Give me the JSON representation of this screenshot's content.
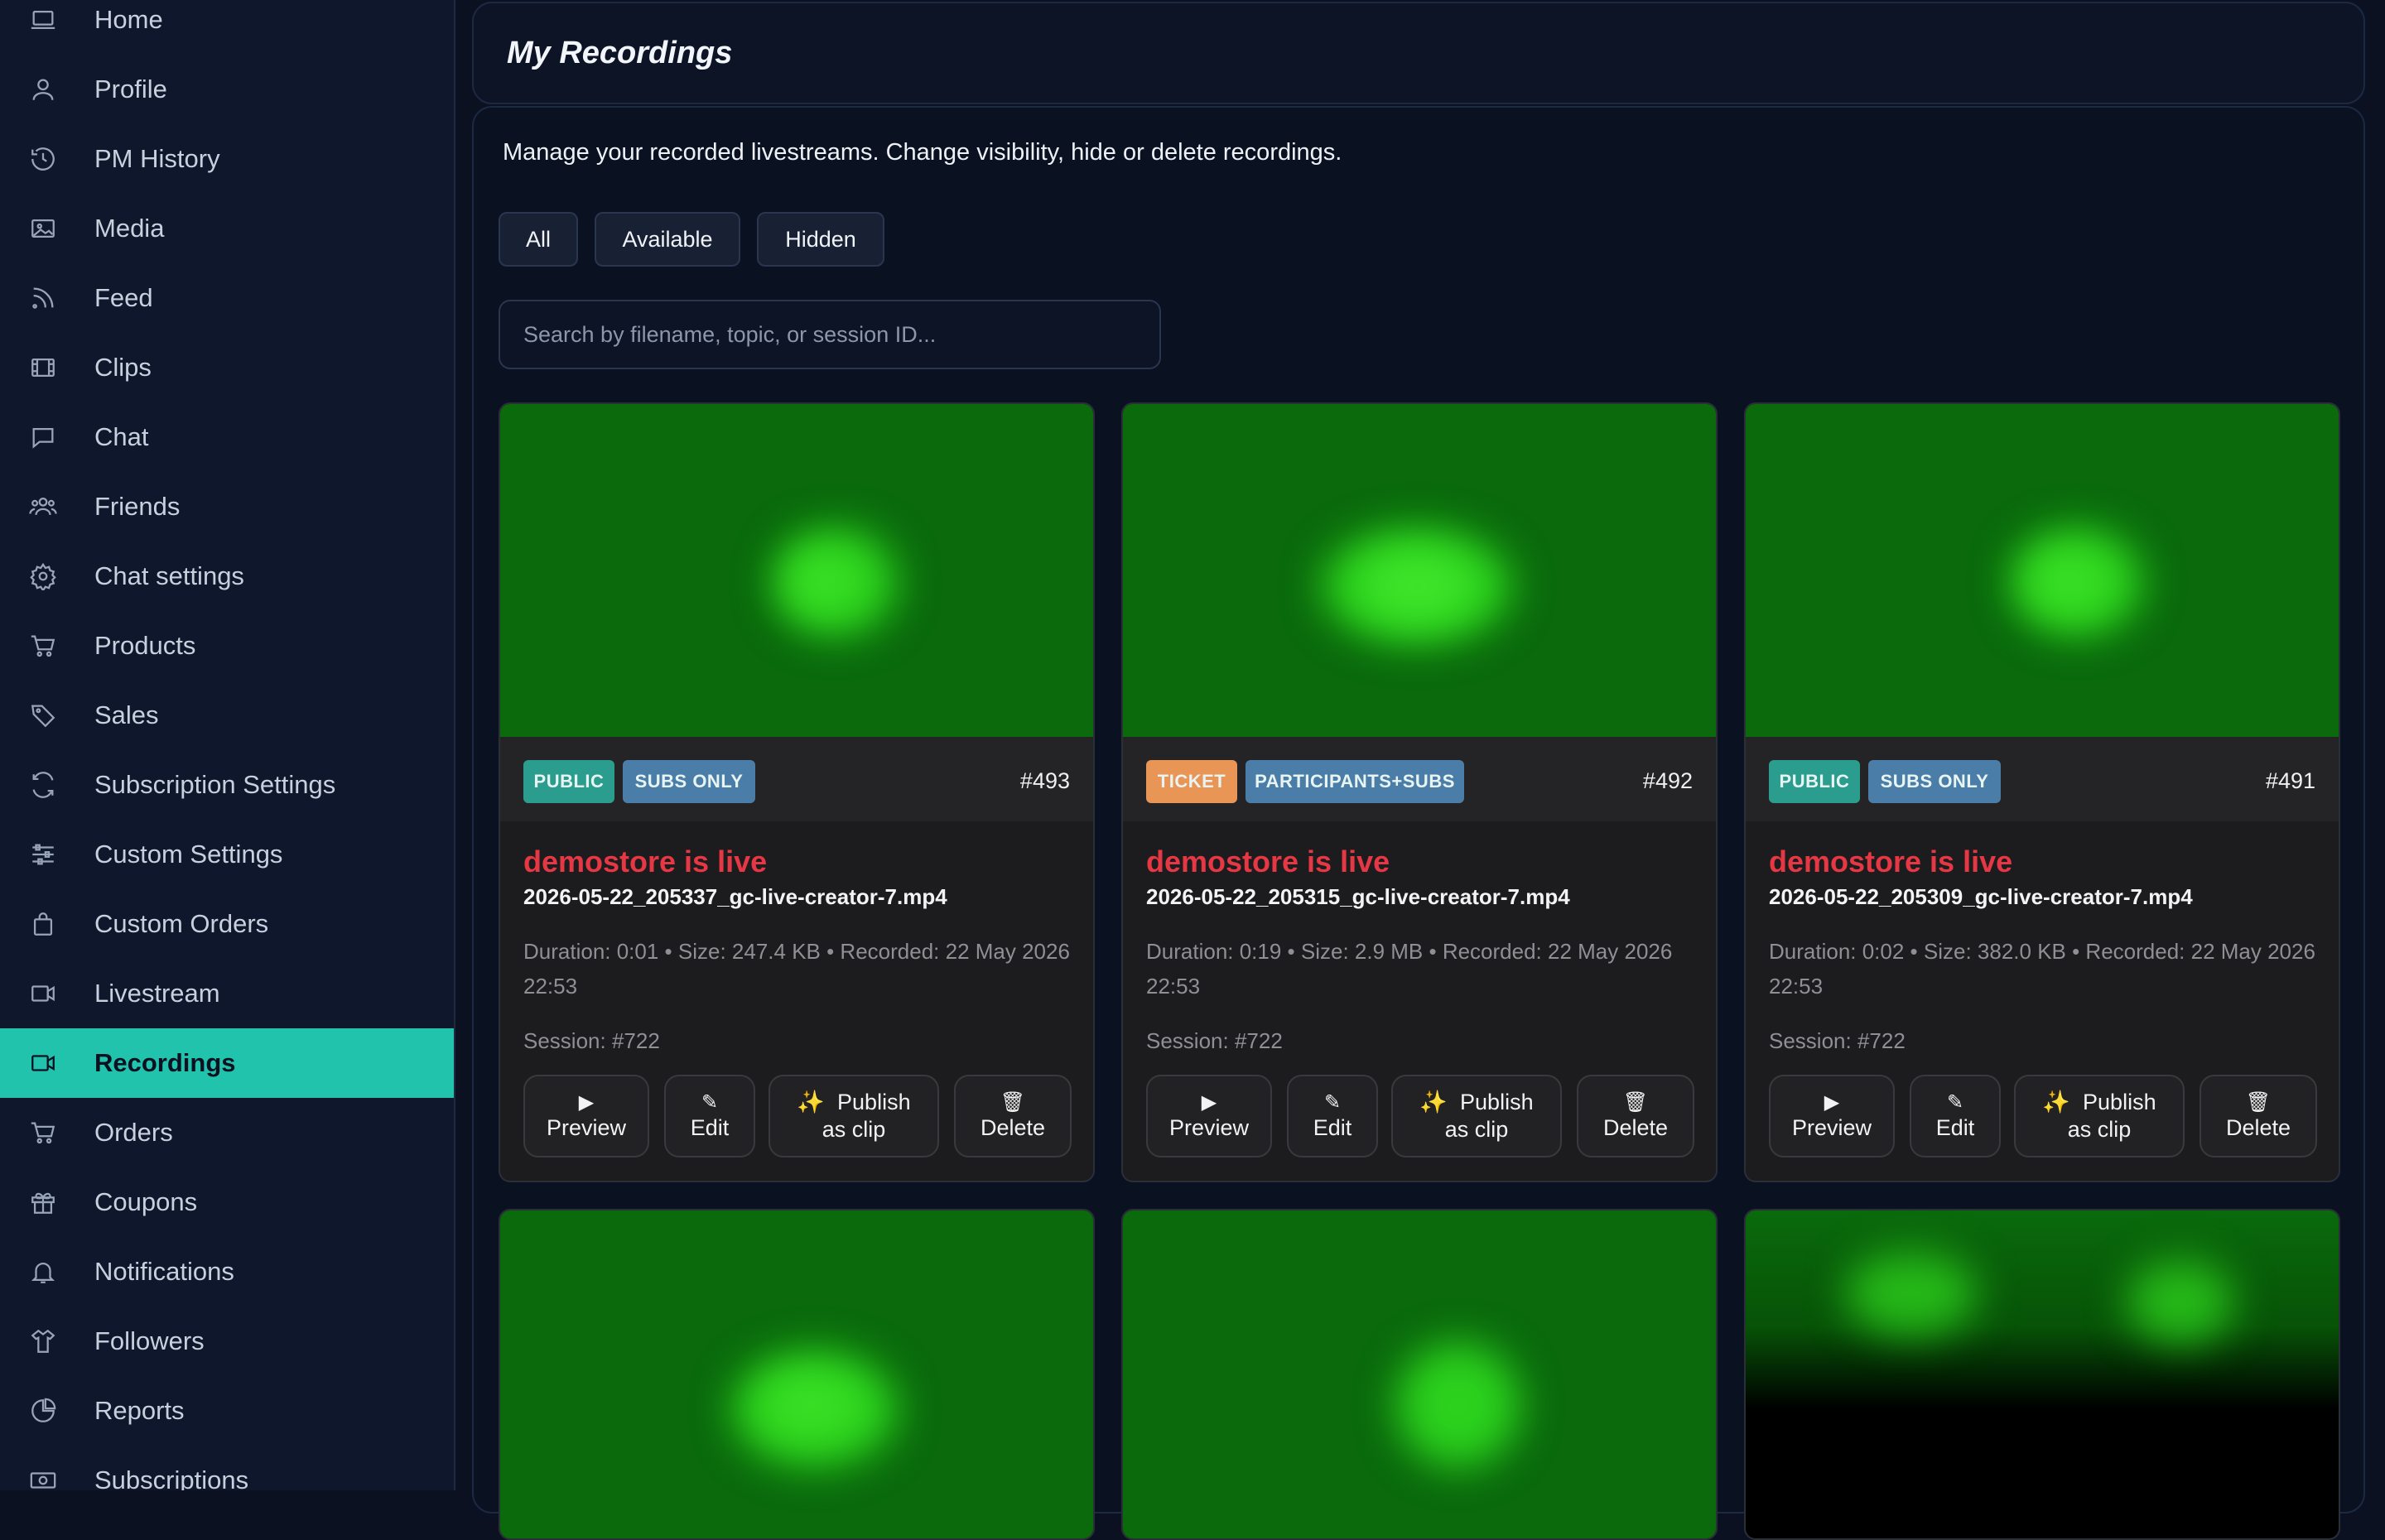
{
  "sidebar": {
    "items": [
      {
        "label": "Home",
        "icon": "laptop-icon"
      },
      {
        "label": "Profile",
        "icon": "user-icon"
      },
      {
        "label": "PM History",
        "icon": "history-icon"
      },
      {
        "label": "Media",
        "icon": "image-icon"
      },
      {
        "label": "Feed",
        "icon": "rss-icon"
      },
      {
        "label": "Clips",
        "icon": "film-icon"
      },
      {
        "label": "Chat",
        "icon": "chat-icon"
      },
      {
        "label": "Friends",
        "icon": "users-icon"
      },
      {
        "label": "Chat settings",
        "icon": "gear-icon"
      },
      {
        "label": "Products",
        "icon": "cart-icon"
      },
      {
        "label": "Sales",
        "icon": "tags-icon"
      },
      {
        "label": "Subscription Settings",
        "icon": "refresh-icon"
      },
      {
        "label": "Custom Settings",
        "icon": "sliders-icon"
      },
      {
        "label": "Custom Orders",
        "icon": "bag-icon"
      },
      {
        "label": "Livestream",
        "icon": "video-icon"
      },
      {
        "label": "Recordings",
        "icon": "video-icon",
        "active": true
      },
      {
        "label": "Orders",
        "icon": "cart-icon"
      },
      {
        "label": "Coupons",
        "icon": "gift-icon"
      },
      {
        "label": "Notifications",
        "icon": "bell-icon"
      },
      {
        "label": "Followers",
        "icon": "shirt-icon"
      },
      {
        "label": "Reports",
        "icon": "pie-chart-icon"
      },
      {
        "label": "Subscriptions",
        "icon": "cash-icon"
      }
    ]
  },
  "header": {
    "title": "My Recordings"
  },
  "main": {
    "description": "Manage your recorded livestreams. Change visibility, hide or delete recordings.",
    "filters": [
      "All",
      "Available",
      "Hidden"
    ],
    "search": {
      "placeholder": "Search by filename, topic, or session ID...",
      "value": ""
    }
  },
  "actions": {
    "preview": "Preview",
    "edit": "Edit",
    "publish_line1": "Publish",
    "publish_line2": "as clip",
    "delete": "Delete",
    "preview_icon": "▶",
    "edit_icon": "✎",
    "publish_icon": "✨",
    "delete_icon": "🗑"
  },
  "recordings": [
    {
      "badge1": "PUBLIC",
      "badge2": "SUBS ONLY",
      "id": "#493",
      "title": "demostore is live",
      "filename": "2026-05-22_205337_gc-live-creator-7.mp4",
      "meta": "Duration: 0:01 • Size: 247.4 KB • Recorded: 22 May 2026 22:53",
      "session": "Session: #722"
    },
    {
      "badge1": "TICKET",
      "badge2": "PARTICIPANTS+SUBS",
      "id": "#492",
      "title": "demostore is live",
      "filename": "2026-05-22_205315_gc-live-creator-7.mp4",
      "meta": "Duration: 0:19 • Size: 2.9 MB • Recorded: 22 May 2026 22:53",
      "session": "Session: #722"
    },
    {
      "badge1": "PUBLIC",
      "badge2": "SUBS ONLY",
      "id": "#491",
      "title": "demostore is live",
      "filename": "2026-05-22_205309_gc-live-creator-7.mp4",
      "meta": "Duration: 0:02 • Size: 382.0 KB • Recorded: 22 May 2026 22:53",
      "session": "Session: #722"
    }
  ],
  "colors": {
    "accent": "#22c3ad",
    "title_red": "#e53744",
    "public": "#2a9d8f",
    "subs": "#4a7ea8",
    "ticket": "#e89556"
  }
}
